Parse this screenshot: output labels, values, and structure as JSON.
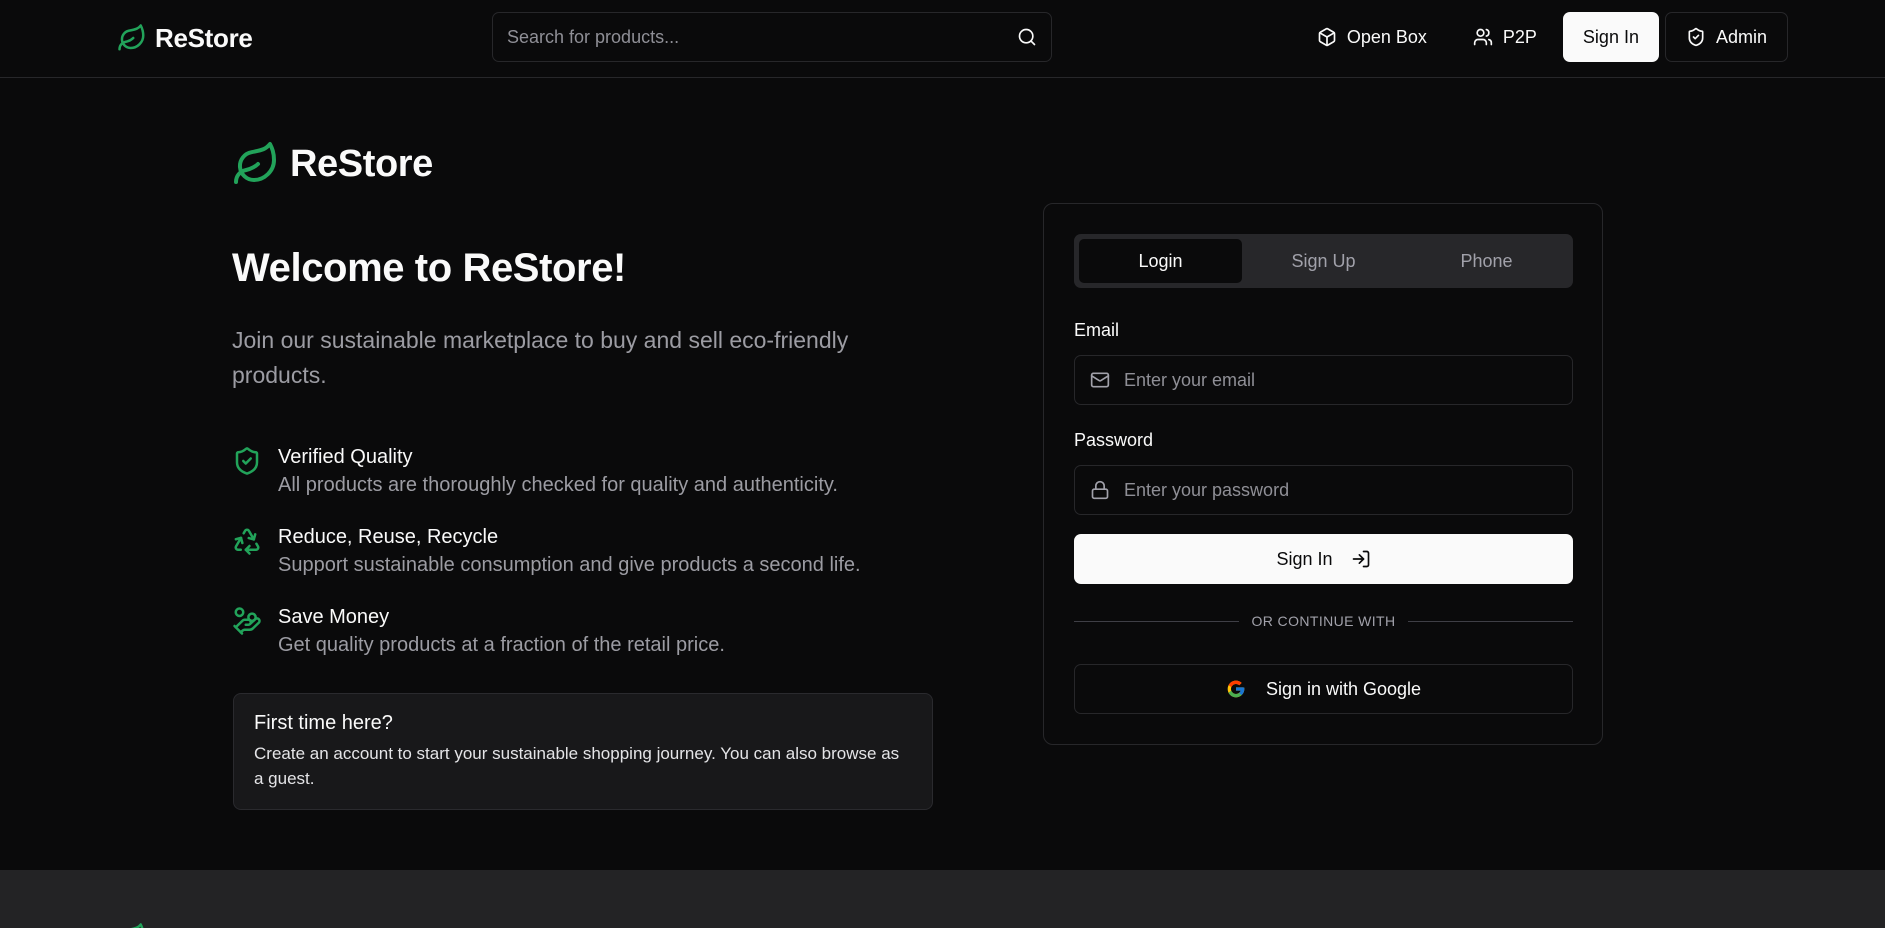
{
  "header": {
    "brand": "ReStore",
    "search_placeholder": "Search for products...",
    "nav": {
      "open_box": "Open Box",
      "p2p": "P2P",
      "sign_in": "Sign In",
      "admin": "Admin"
    }
  },
  "hero": {
    "brand": "ReStore",
    "title": "Welcome to ReStore!",
    "subtitle": "Join our sustainable marketplace to buy and sell eco-friendly products.",
    "features": [
      {
        "icon": "shield-check-icon",
        "title": "Verified Quality",
        "desc": "All products are thoroughly checked for quality and authenticity."
      },
      {
        "icon": "recycle-icon",
        "title": "Reduce, Reuse, Recycle",
        "desc": "Support sustainable consumption and give products a second life."
      },
      {
        "icon": "hand-coins-icon",
        "title": "Save Money",
        "desc": "Get quality products at a fraction of the retail price."
      }
    ],
    "first_time": {
      "title": "First time here?",
      "text": "Create an account to start your sustainable shopping journey. You can also browse as a guest."
    }
  },
  "auth": {
    "tabs": [
      "Login",
      "Sign Up",
      "Phone"
    ],
    "active_tab": "Login",
    "email_label": "Email",
    "email_placeholder": "Enter your email",
    "password_label": "Password",
    "password_placeholder": "Enter your password",
    "sign_in": "Sign In",
    "divider": "OR CONTINUE WITH",
    "google": "Sign in with Google"
  },
  "colors": {
    "background": "#0a0a0b",
    "accent_green": "#22a35a",
    "primary_button": "#fafafa",
    "footer": "#232325"
  }
}
